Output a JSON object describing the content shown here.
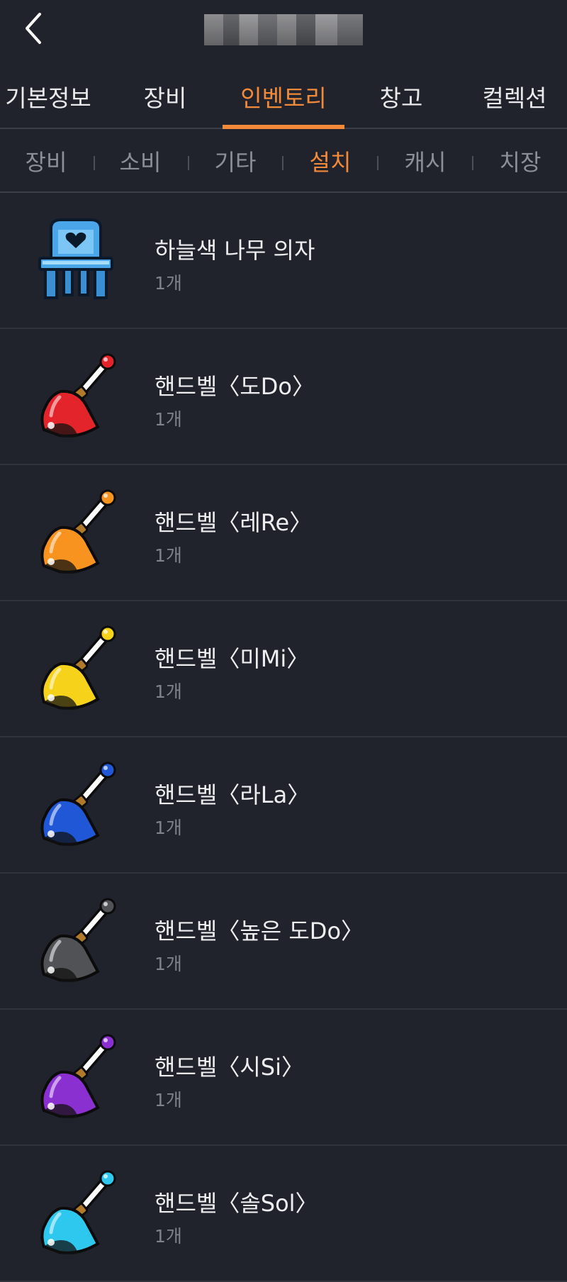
{
  "main_tabs": [
    "기본정보",
    "장비",
    "인벤토리",
    "창고",
    "컬렉션"
  ],
  "main_tabs_active": 2,
  "sub_tabs": [
    "장비",
    "소비",
    "기타",
    "설치",
    "캐시",
    "치장"
  ],
  "sub_tabs_active": 3,
  "colors": {
    "accent": "#f28a3a",
    "background": "#20232b"
  },
  "items": [
    {
      "name": "하늘색 나무 의자",
      "count": "1개",
      "icon": "sky-blue-chair-icon",
      "color": "#4aa6e8"
    },
    {
      "name": "핸드벨〈도Do〉",
      "count": "1개",
      "icon": "red-bell-icon",
      "color": "#e3242b"
    },
    {
      "name": "핸드벨〈레Re〉",
      "count": "1개",
      "icon": "orange-bell-icon",
      "color": "#f7931e"
    },
    {
      "name": "핸드벨〈미Mi〉",
      "count": "1개",
      "icon": "yellow-bell-icon",
      "color": "#f7d21a"
    },
    {
      "name": "핸드벨〈라La〉",
      "count": "1개",
      "icon": "blue-bell-icon",
      "color": "#1f57d6"
    },
    {
      "name": "핸드벨〈높은 도Do〉",
      "count": "1개",
      "icon": "black-bell-icon",
      "color": "#505256"
    },
    {
      "name": "핸드벨〈시Si〉",
      "count": "1개",
      "icon": "purple-bell-icon",
      "color": "#8a2fd0"
    },
    {
      "name": "핸드벨〈솔Sol〉",
      "count": "1개",
      "icon": "cyan-bell-icon",
      "color": "#2ec8ef"
    }
  ]
}
